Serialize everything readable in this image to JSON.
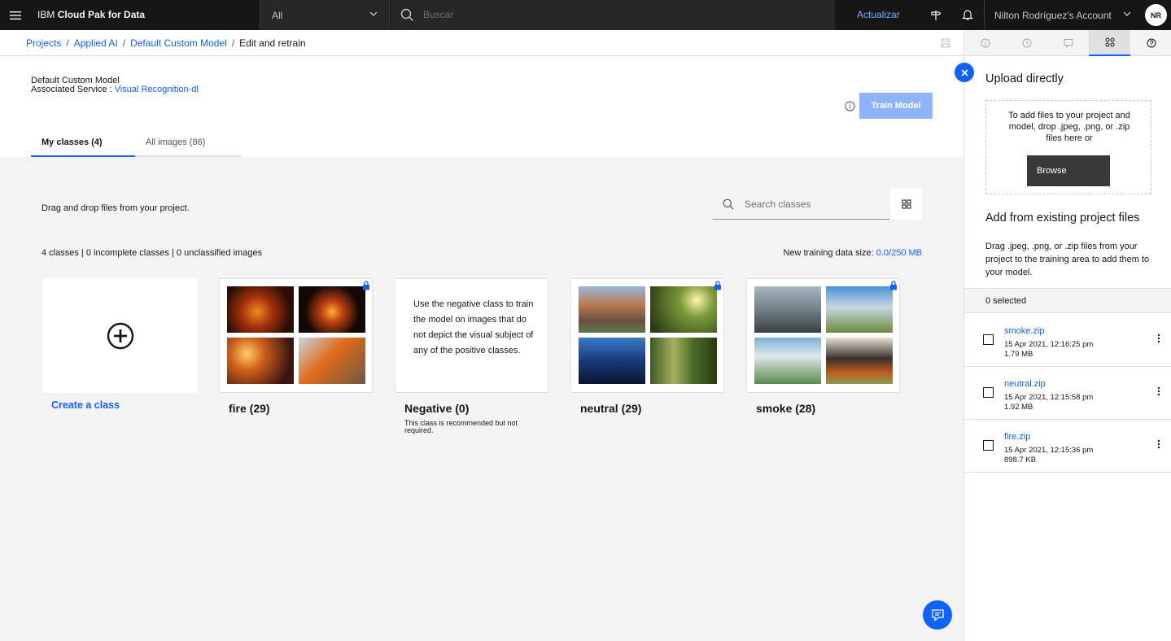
{
  "header": {
    "brand_prefix": "IBM",
    "brand_name": "Cloud Pak for Data",
    "scope_value": "All",
    "search_placeholder": "Buscar",
    "upgrade_label": "Actualizar",
    "account_label": "Nilton Rodríguez's Account",
    "avatar_initials": "NR"
  },
  "breadcrumb": {
    "items": [
      "Projects",
      "Applied AI",
      "Default Custom Model"
    ],
    "current": "Edit and retrain"
  },
  "model": {
    "name": "Default Custom Model",
    "service_label": "Associated Service :",
    "service_link": "Visual Recognition-dl",
    "train_label": "Train Model"
  },
  "tabs": [
    {
      "label": "My classes (4)"
    },
    {
      "label": "All images (86)"
    }
  ],
  "work": {
    "drag_hint": "Drag and drop files from your project.",
    "search_placeholder": "Search classes",
    "stats": "4 classes | 0 incomplete classes | 0 unclassified images",
    "size_label": "New training data size:",
    "size_value": "0.0/250 MB",
    "create_label": "Create a class"
  },
  "classes": [
    {
      "title": "fire (29)",
      "thumbs": [
        "#3a1a08",
        "#1a0f0a",
        "#4a2410",
        "#6d5a45"
      ]
    },
    {
      "title": "Negative (0)",
      "body": "Use the negative class to train the model on images that do not depict the visual subject of any of the positive classes.",
      "note": "This class is recommended but not required."
    },
    {
      "title": "neutral (29)",
      "thumbs": [
        "#8a6a52",
        "#5a6a2a",
        "#1c3a6a",
        "#5a7a35"
      ]
    },
    {
      "title": "smoke (28)",
      "thumbs": [
        "#7a8a90",
        "#6a9abf",
        "#9ab0a8",
        "#5a4a3a"
      ]
    }
  ],
  "panel": {
    "upload_title": "Upload directly",
    "drop_text": "To add files to your project and model, drop .jpeg, .png, or .zip files here or",
    "browse_label": "Browse",
    "existing_title": "Add from existing project files",
    "existing_desc": "Drag .jpeg, .png, or .zip files from your project to the training area to add them to your model.",
    "selected_label": "0 selected",
    "files": [
      {
        "name": "smoke.zip",
        "date": "15 Apr 2021, 12:16:25 pm",
        "size": "1.79 MB"
      },
      {
        "name": "neutral.zip",
        "date": "15 Apr 2021, 12:15:58 pm",
        "size": "1.92 MB"
      },
      {
        "name": "fire.zip",
        "date": "15 Apr 2021, 12:15:36 pm",
        "size": "898.7 KB"
      }
    ]
  },
  "colors": {
    "accent": "#0f62fe",
    "header_bg": "#161616",
    "work_bg": "#f4f4f4",
    "train_disabled": "#8fb3fb"
  }
}
